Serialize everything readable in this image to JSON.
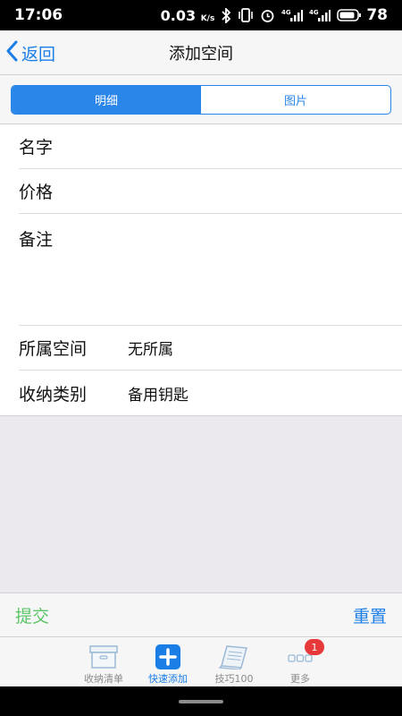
{
  "status_bar": {
    "time": "17:06",
    "speed": "0.03",
    "speed_unit": "K/s",
    "battery": "78"
  },
  "nav": {
    "back_label": "返回",
    "title": "添加空间"
  },
  "segments": [
    {
      "label": "明细",
      "active": true
    },
    {
      "label": "图片",
      "active": false
    }
  ],
  "form": {
    "name_label": "名字",
    "price_label": "价格",
    "notes_label": "备注",
    "space_label": "所属空间",
    "space_value": "无所属",
    "category_label": "收纳类别",
    "category_value": "备用钥匙"
  },
  "actions": {
    "submit": "提交",
    "reset": "重置"
  },
  "tabs": [
    {
      "label": "收纳清单",
      "icon": "box-icon",
      "active": false
    },
    {
      "label": "快速添加",
      "icon": "plus-icon",
      "active": true
    },
    {
      "label": "技巧100",
      "icon": "book-icon",
      "active": false
    },
    {
      "label": "更多",
      "icon": "more-icon",
      "active": false,
      "badge": "1"
    }
  ],
  "colors": {
    "accent": "#1a7ee6",
    "submit": "#5cc567",
    "badge": "#e8393a",
    "background": "#ebe9ee"
  }
}
